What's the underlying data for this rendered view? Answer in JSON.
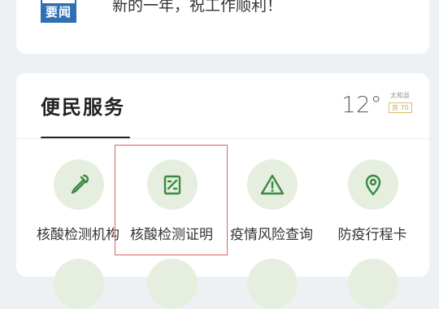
{
  "news": {
    "badge": "要闻",
    "headline": "新的一年，祝工作顺利！"
  },
  "services": {
    "title": "便民服务",
    "weather": {
      "temperature": "12°",
      "city": "太和县",
      "aqi": "良 70"
    },
    "items": [
      {
        "label": "核酸检测机构",
        "icon": "dropper-icon"
      },
      {
        "label": "核酸检测证明",
        "icon": "certificate-icon"
      },
      {
        "label": "疫情风险查询",
        "icon": "warning-icon"
      },
      {
        "label": "防疫行程卡",
        "icon": "location-pin-icon"
      }
    ]
  },
  "colors": {
    "accent_green": "#3a8a43",
    "icon_bg": "#e6efdf",
    "news_blue": "#2f6fb3",
    "highlight_red": "#e06060"
  }
}
